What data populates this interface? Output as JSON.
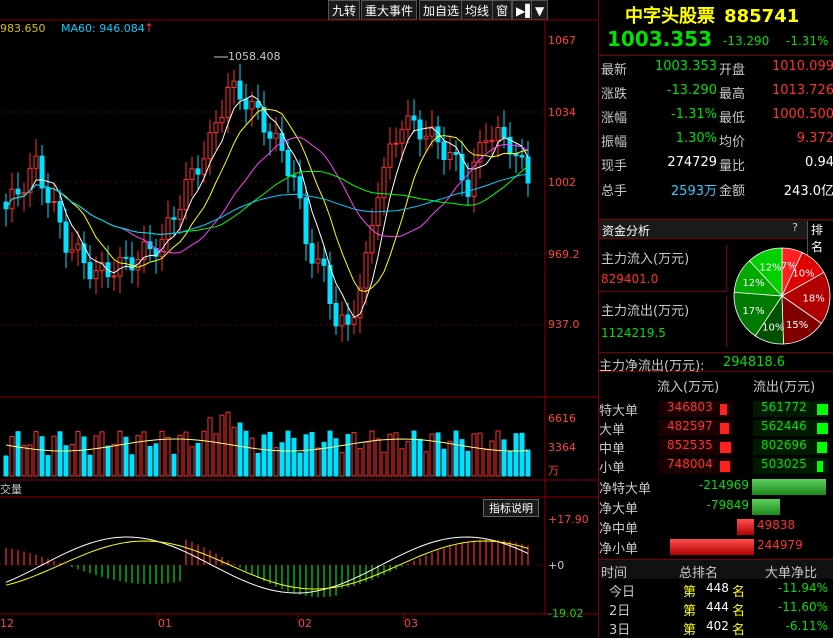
{
  "toolbar": {
    "items": [
      "九转",
      "重大事件",
      "加自选",
      "均线",
      "窗",
      "▶▌",
      "▼"
    ]
  },
  "ma_legend": {
    "ma_a": "983.650",
    "ma60": "MA60: 946.084",
    "arrow": "↑"
  },
  "price_axis": [
    "1067",
    "1034",
    "1002",
    "969.2",
    "937.0"
  ],
  "annotation_high": "1058.408",
  "volume_axis": [
    "6616",
    "3364",
    "万"
  ],
  "macd_axis": [
    "+17.90",
    "+0",
    "-19.02"
  ],
  "indicator_button": "指标说明",
  "volume_label": "交量",
  "month_labels": [
    "12",
    "01",
    "02",
    "03"
  ],
  "stock": {
    "name": "中字头股票",
    "code": "885741",
    "price": "1003.353",
    "change": "-13.290",
    "change_pct": "-1.31%"
  },
  "quote": {
    "rows": [
      {
        "l1": "最新",
        "v1": "1003.353",
        "l2": "开盘",
        "v2": "1010.099"
      },
      {
        "l1": "涨跌",
        "v1": "-13.290",
        "l2": "最高",
        "v2": "1013.726"
      },
      {
        "l1": "涨幅",
        "v1": "-1.31%",
        "l2": "最低",
        "v2": "1000.500"
      },
      {
        "l1": "振幅",
        "v1": "1.30%",
        "l2": "均价",
        "v2": "9.372"
      },
      {
        "l1": "现手",
        "v1": "274729",
        "l2": "量比",
        "v2": "0.94"
      },
      {
        "l1": "总手",
        "v1": "2593万",
        "l2": "金额",
        "v2": "243.0亿"
      }
    ]
  },
  "capital": {
    "tab_label": "资金分析",
    "help": "?",
    "rank_tab": "排名",
    "inflow_label": "主力流入(万元)",
    "inflow_value": "829401.0",
    "outflow_label": "主力流出(万元)",
    "outflow_value": "1124219.5",
    "net_label": "主力净流出(万元):",
    "net_value": "294818.6",
    "pie": [
      {
        "label": "7%",
        "value": 7,
        "color": "#ff2020"
      },
      {
        "label": "10%",
        "value": 10,
        "color": "#e00000"
      },
      {
        "label": "18%",
        "value": 18,
        "color": "#b00000"
      },
      {
        "label": "15%",
        "value": 15,
        "color": "#800000"
      },
      {
        "label": "10%",
        "value": 10,
        "color": "#005000"
      },
      {
        "label": "17%",
        "value": 17,
        "color": "#007a00"
      },
      {
        "label": "12%",
        "value": 12,
        "color": "#00a800"
      },
      {
        "label": "12%",
        "value": 12,
        "color": "#00d000"
      }
    ],
    "flow_header_in": "流入(万元)",
    "flow_header_out": "流出(万元)",
    "flows": [
      {
        "label": "特大单",
        "in": "346803",
        "out": "561772",
        "in_ratio": 0.62,
        "out_ratio": 1.0
      },
      {
        "label": "大单",
        "in": "482597",
        "out": "562446",
        "in_ratio": 0.86,
        "out_ratio": 1.0
      },
      {
        "label": "中单",
        "in": "852535",
        "out": "802696",
        "in_ratio": 1.0,
        "out_ratio": 0.94
      },
      {
        "label": "小单",
        "in": "748004",
        "out": "503025",
        "in_ratio": 0.88,
        "out_ratio": 0.59
      }
    ],
    "net": [
      {
        "label": "净特大单",
        "value": "-214969",
        "ratio": 0.88,
        "sign": -1
      },
      {
        "label": "净大单",
        "value": "-79849",
        "ratio": 0.33,
        "sign": -1
      },
      {
        "label": "净中单",
        "value": "49838",
        "ratio": 0.2,
        "sign": 1
      },
      {
        "label": "净小单",
        "value": "244979",
        "ratio": 1.0,
        "sign": 1
      }
    ],
    "rank_header": {
      "time": "时间",
      "rank": "总排名",
      "ratio": "大单净比"
    },
    "rank_rows": [
      {
        "time": "今日",
        "prefix": "第",
        "rank": "448",
        "suffix": "名",
        "ratio": "-11.94%"
      },
      {
        "time": "2日",
        "prefix": "第",
        "rank": "444",
        "suffix": "名",
        "ratio": "-11.60%"
      },
      {
        "time": "3日",
        "prefix": "第",
        "rank": "402",
        "suffix": "名",
        "ratio": "-6.11%"
      }
    ]
  },
  "colors": {
    "up": "#ff3030",
    "down": "#00e0ff",
    "ma5": "#ffffff",
    "ma10": "#ffff00",
    "ma20": "#ff40ff",
    "ma30": "#00ff00",
    "ma60": "#00ccff"
  }
}
